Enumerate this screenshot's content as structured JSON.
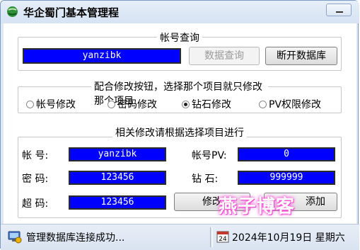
{
  "window": {
    "title": "华企蜀门基本管理程"
  },
  "account_query": {
    "group_title": "帐号查询",
    "account_value": "yanzibk",
    "query_button": "数据查询",
    "disconnect_button": "断开数据库"
  },
  "modify_options": {
    "group_title": "配合修改按钮，选择那个项目就只修改那个项目",
    "options": [
      {
        "label": "帐号修改",
        "checked": false
      },
      {
        "label": "密码修改",
        "checked": false
      },
      {
        "label": "钻石修改",
        "checked": true
      },
      {
        "label": "PV权限修改",
        "checked": false
      }
    ]
  },
  "details": {
    "group_title": "相关修改请根据选择项目进行",
    "account_label": "帐  号:",
    "account_value": "yanzibk",
    "account_pv_label": "帐号PV:",
    "account_pv_value": "0",
    "password_label": "密  码:",
    "password_value": "123456",
    "diamond_label": "钻  石:",
    "diamond_value": "999999",
    "super_password_label": "超  码:",
    "super_password_value": "123456",
    "modify_button": "修改",
    "add_button": "添加"
  },
  "status": {
    "message": "管理数据库连接成功...",
    "date": "2024年10月19日 星期六"
  },
  "watermark": "燕子博客",
  "colors": {
    "field_bg": "#0000ff",
    "window_frame": "#dfe8f5"
  }
}
